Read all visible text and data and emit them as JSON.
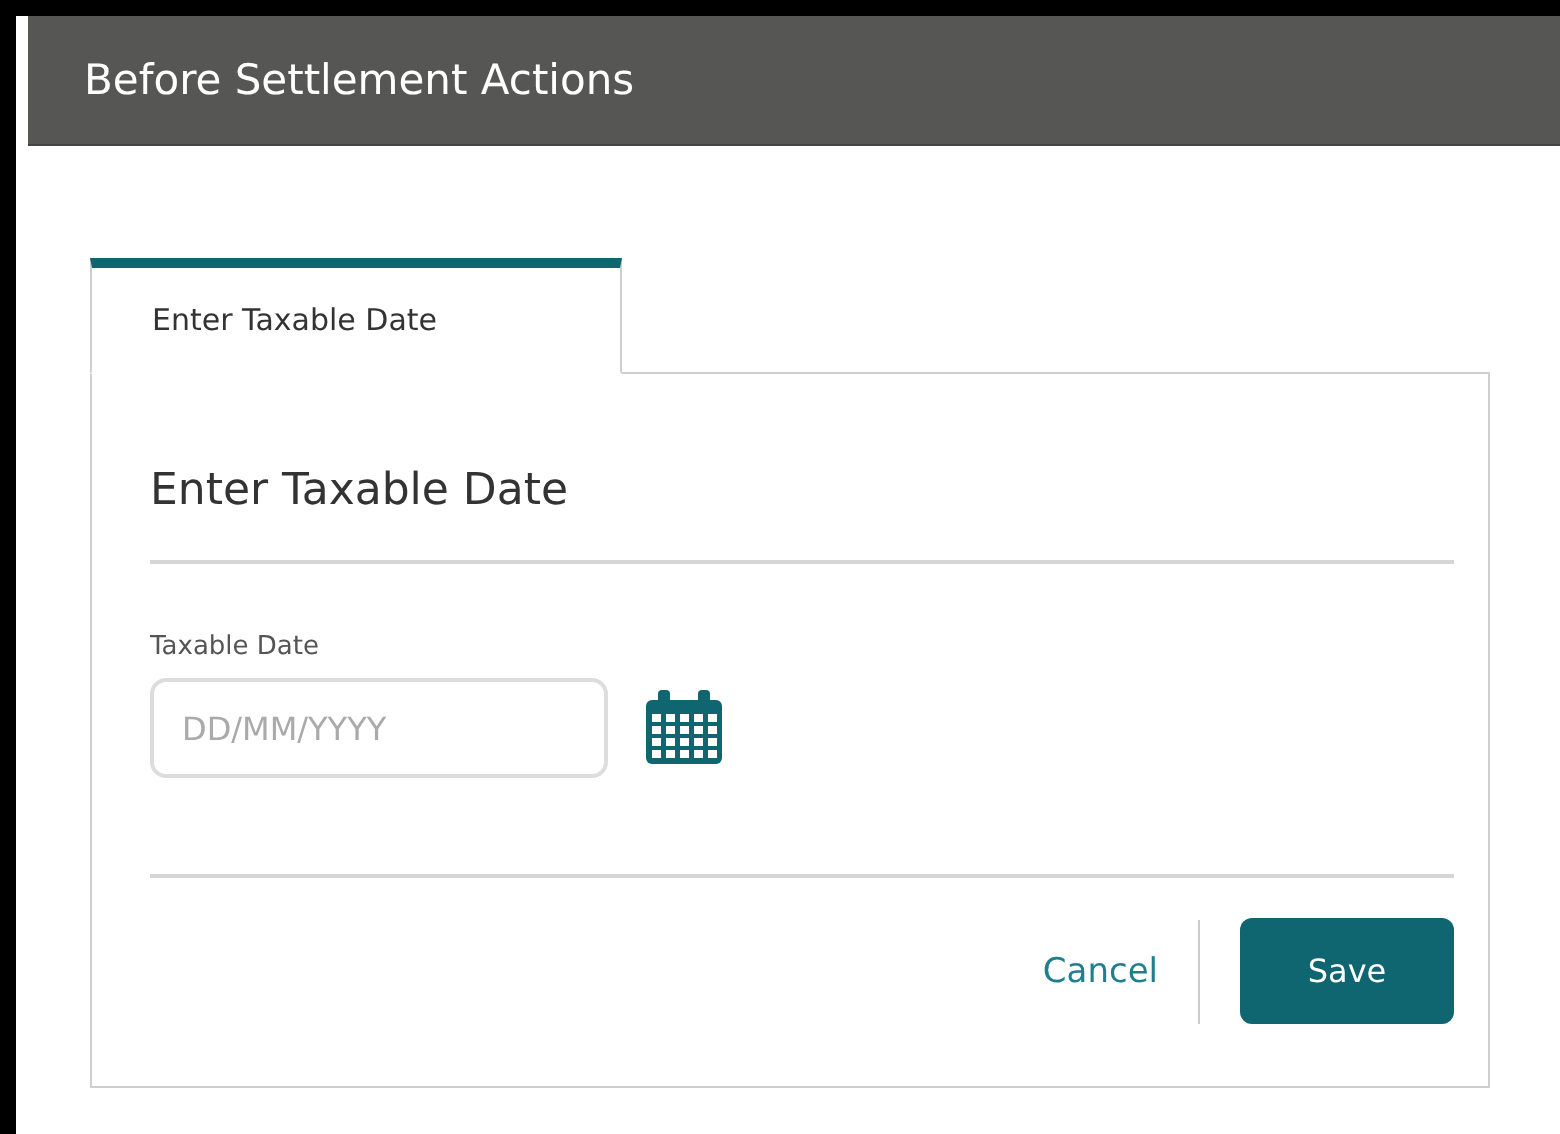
{
  "window": {
    "title": "Before Settlement Actions"
  },
  "tabs": [
    {
      "label": "Enter Taxable Date",
      "selected": true
    }
  ],
  "section": {
    "title": "Enter Taxable Date"
  },
  "field": {
    "label": "Taxable Date",
    "placeholder": "DD/MM/YYYY"
  },
  "buttons": [
    {
      "label": "Cancel",
      "kind": "link"
    },
    {
      "label": "Save",
      "kind": "primary"
    }
  ]
}
